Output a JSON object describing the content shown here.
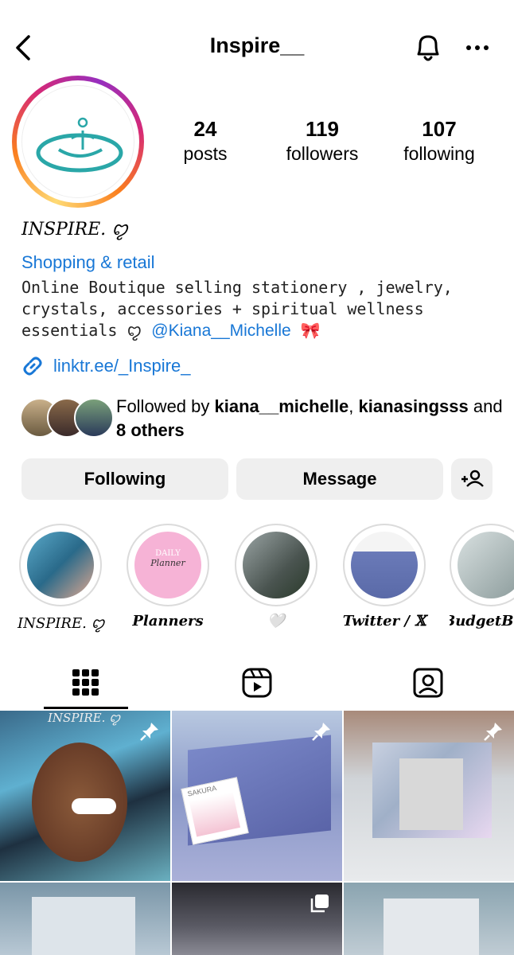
{
  "header": {
    "title": "Inspire__"
  },
  "stats": [
    {
      "value": "24",
      "label": "posts"
    },
    {
      "value": "119",
      "label": "followers"
    },
    {
      "value": "107",
      "label": "following"
    }
  ],
  "profile": {
    "name": "INSPIRE. ꨄ",
    "category": "Shopping & retail",
    "bio_line1": "Online Boutique selling stationery , jewelry,",
    "bio_line2": "crystals, accessories + spiritual wellness",
    "bio_line3_prefix": "essentials ꨄ",
    "bio_mention": "@Kiana__Michelle",
    "bio_emoji": "🎀",
    "link": "linktr.ee/_Inspire_"
  },
  "followed_by": {
    "prefix": "Followed by",
    "user1": "kiana__michelle",
    "separator": ",",
    "user2": "kianasingsss",
    "and": "and",
    "others": "8 others"
  },
  "actions": {
    "following_label": "Following",
    "message_label": "Message"
  },
  "highlights": [
    {
      "label": "INSPIRE. ꨄ"
    },
    {
      "label": "Planners"
    },
    {
      "label": "🤍"
    },
    {
      "label": "Twitter / 𝕏"
    },
    {
      "label": "BudgetBin"
    }
  ],
  "highlight_planner_text": {
    "line1": "DAILY",
    "line2": "Planner"
  },
  "grid_overlay_text": "INSPIRE. ꨄ",
  "grid_box_label": "SAKURA",
  "colors": {
    "link_blue": "#1877d6",
    "button_bg": "#efefef",
    "teal_logo": "#2aa7a8"
  }
}
